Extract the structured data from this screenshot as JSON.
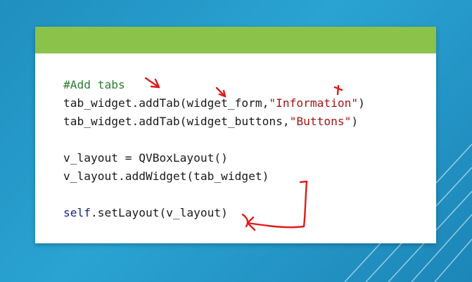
{
  "slide": {
    "header_color": "#8bc34a",
    "background_color": "#2aa3d2"
  },
  "code": {
    "comment": "#Add tabs",
    "line2": {
      "before": "tab_widget.addTab(widget_form,",
      "string": "\"Information\"",
      "after": ")"
    },
    "line3": {
      "before": "tab_widget.addTab(widget_buttons,",
      "string": "\"Buttons\"",
      "after": ")"
    },
    "line4": "v_layout = QVBoxLayout()",
    "line5": "v_layout.addWidget(tab_widget)",
    "line6": {
      "keyword": "self",
      "rest": ".setLayout(v_layout)"
    }
  },
  "annotations": {
    "color": "#e01a1a",
    "marks": [
      "arrow",
      "arrow",
      "arrow",
      "bracket-arrow"
    ]
  }
}
